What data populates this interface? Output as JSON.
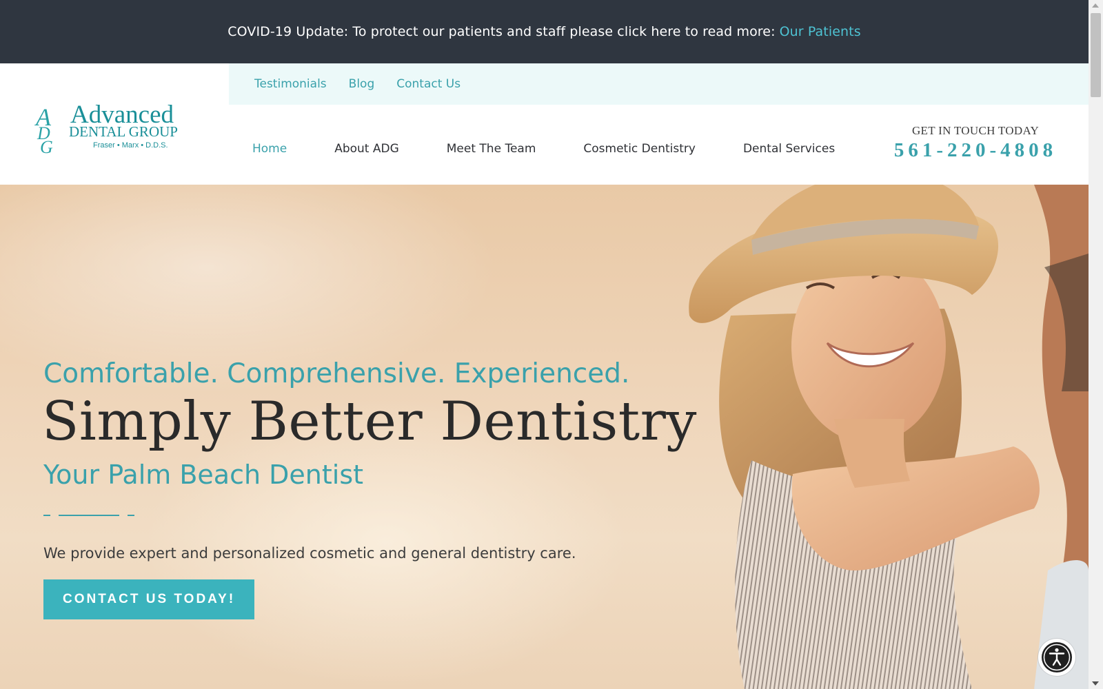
{
  "announcement": {
    "text": "COVID-19 Update: To protect our patients and staff please click here to read more:",
    "link": "Our Patients"
  },
  "logo": {
    "monogram": "ADG",
    "line1": "Advanced",
    "line2": "DENTAL GROUP",
    "line3": "Fraser • Marx • D.D.S."
  },
  "utility_nav": [
    "Testimonials",
    "Blog",
    "Contact Us"
  ],
  "main_nav": {
    "items": [
      "Home",
      "About ADG",
      "Meet The Team",
      "Cosmetic Dentistry",
      "Dental Services"
    ],
    "active": "Home"
  },
  "contact": {
    "label": "GET IN TOUCH TODAY",
    "phone": "561-220-4808"
  },
  "hero": {
    "tagline": "Comfortable. Comprehensive. Experienced.",
    "headline": "Simply Better Dentistry",
    "subhead": "Your Palm Beach Dentist",
    "description": "We provide expert and personalized cosmetic and general dentistry care.",
    "cta": "CONTACT US TODAY!"
  },
  "colors": {
    "accent": "#3aa1ab",
    "announcement_bg": "#2f3640",
    "utility_bg": "#ecf9f9",
    "cta_bg": "#3bb3bd"
  },
  "icons": {
    "accessibility": "accessibility-icon"
  }
}
